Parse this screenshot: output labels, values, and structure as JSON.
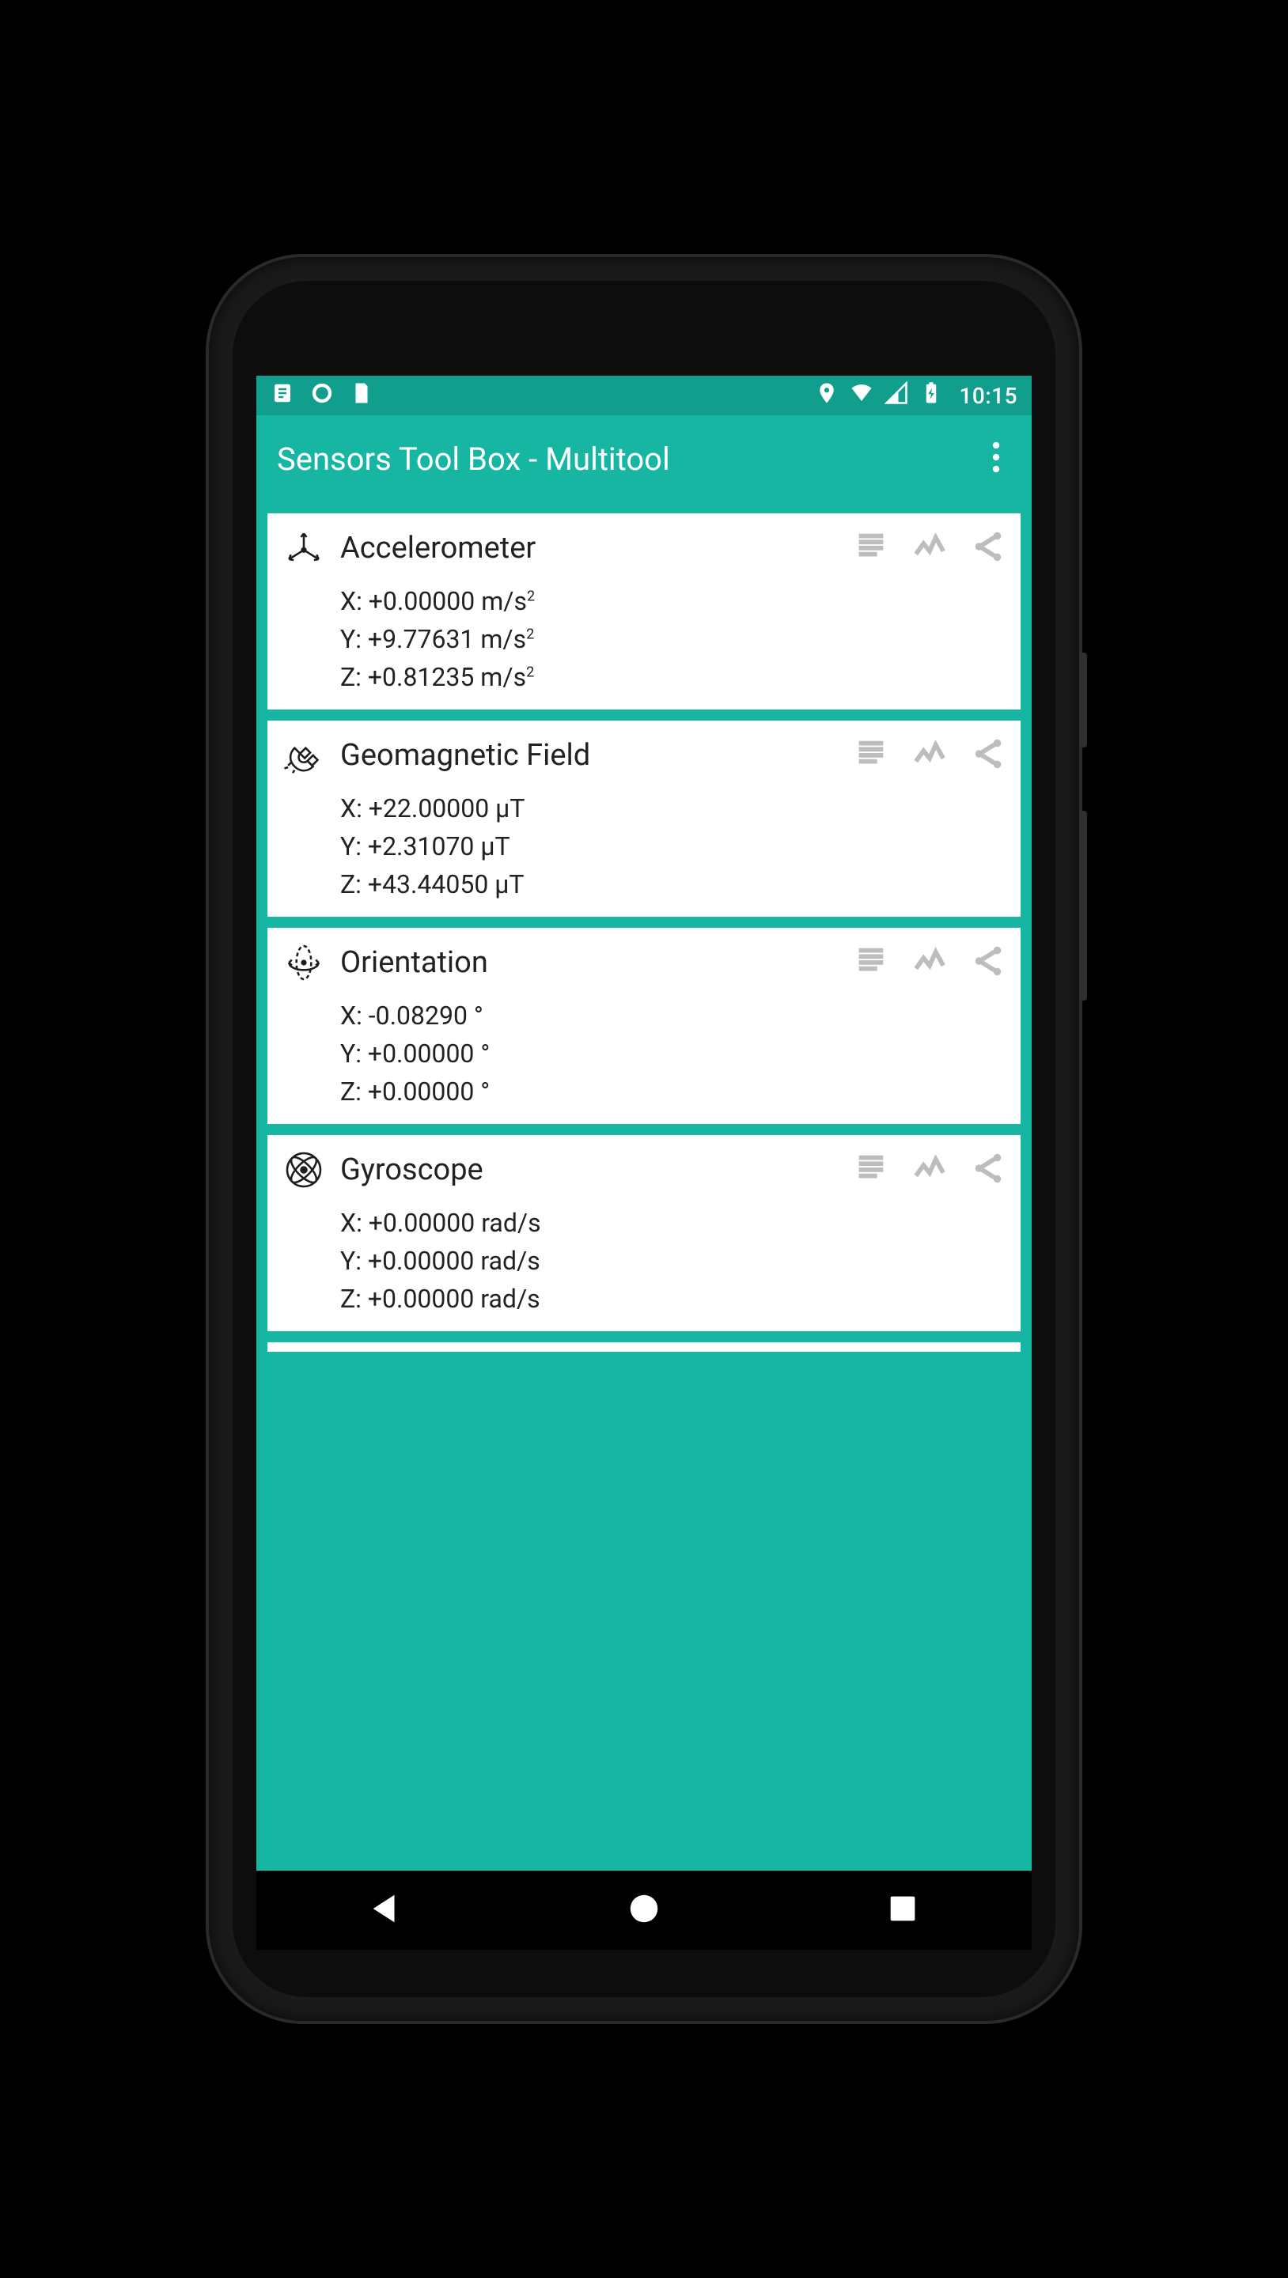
{
  "status": {
    "time": "10:15"
  },
  "app": {
    "title": "Sensors Tool Box - Multitool"
  },
  "sensors": [
    {
      "name": "Accelerometer",
      "icon": "axes-icon",
      "x": "X: +0.00000 m/s",
      "y": "Y: +9.77631 m/s",
      "z": "Z: +0.81235 m/s",
      "unit_sup": "2"
    },
    {
      "name": "Geomagnetic Field",
      "icon": "magnet-icon",
      "x": "X: +22.00000 µT",
      "y": "Y: +2.31070 µT",
      "z": "Z: +43.44050 µT",
      "unit_sup": ""
    },
    {
      "name": "Orientation",
      "icon": "rotation-icon",
      "x": "X: -0.08290 °",
      "y": "Y: +0.00000 °",
      "z": "Z: +0.00000 °",
      "unit_sup": ""
    },
    {
      "name": "Gyroscope",
      "icon": "atom-icon",
      "x": "X: +0.00000 rad/s",
      "y": "Y: +0.00000 rad/s",
      "z": "Z: +0.00000 rad/s",
      "unit_sup": ""
    }
  ]
}
